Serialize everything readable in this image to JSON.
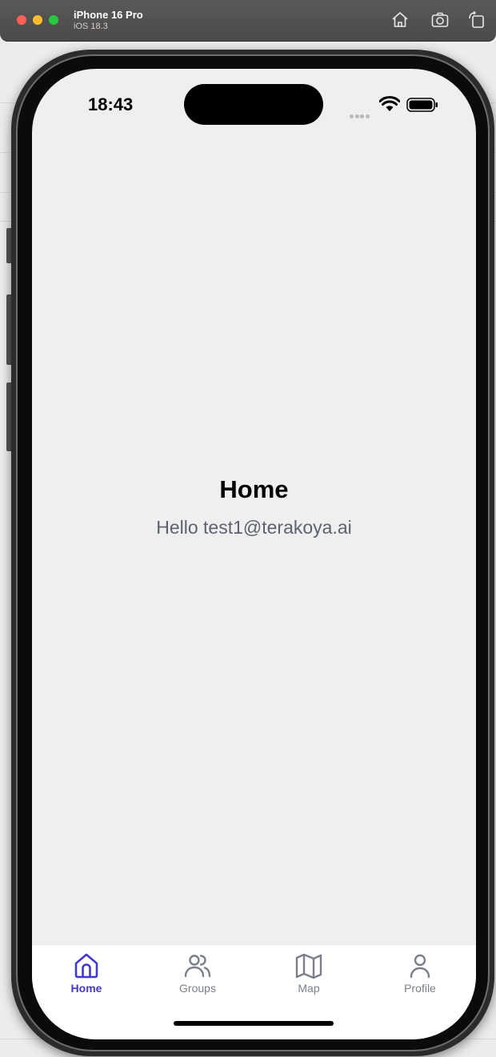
{
  "simulator": {
    "device_name": "iPhone 16 Pro",
    "os_version": "iOS 18.3"
  },
  "status_bar": {
    "time": "18:43"
  },
  "screen": {
    "title": "Home",
    "greeting": "Hello test1@terakoya.ai"
  },
  "tabbar": {
    "active_color": "#4338ca",
    "inactive_color": "#7a7f8a",
    "tabs": [
      {
        "label": "Home",
        "icon": "home-icon",
        "active": true
      },
      {
        "label": "Groups",
        "icon": "users-icon",
        "active": false
      },
      {
        "label": "Map",
        "icon": "map-icon",
        "active": false
      },
      {
        "label": "Profile",
        "icon": "user-icon",
        "active": false
      }
    ]
  }
}
